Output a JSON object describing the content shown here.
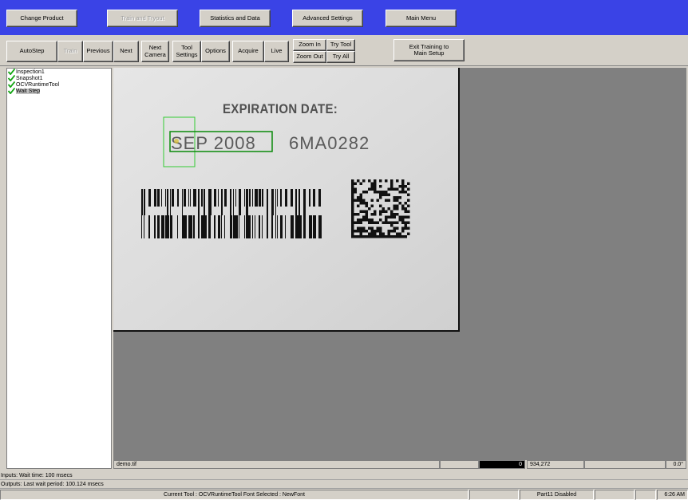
{
  "top_nav": {
    "change_product": "Change Product",
    "train_and_tryout": "Train and Tryout",
    "statistics_and_data": "Statistics and Data",
    "advanced_settings": "Advanced Settings",
    "main_menu": "Main Menu"
  },
  "toolbar": {
    "autostep": "AutoStep",
    "train": "Train",
    "previous": "Previous",
    "next": "Next",
    "next_camera": "Next Camera",
    "tool_settings": "Tool Settings",
    "options": "Options",
    "acquire": "Acquire",
    "live": "Live",
    "zoom_in": "Zoom In",
    "zoom_out": "Zoom Out",
    "try_tool": "Try Tool",
    "try_all": "Try All",
    "exit_training": "Exit Training to Main Setup"
  },
  "tree": {
    "items": [
      {
        "label": "Inspection1",
        "icon": "check-icon"
      },
      {
        "label": "Snapshot1",
        "icon": "check-icon"
      },
      {
        "label": "OCVRuntimeTool",
        "icon": "check-icon"
      },
      {
        "label": "Wait Step",
        "icon": "check-icon",
        "selected": true
      }
    ]
  },
  "image": {
    "expiration_label": "EXPIRATION DATE:",
    "date_text": "SEP 2008",
    "lot_text": "6MA0282"
  },
  "viewer_status": {
    "filename": "demo.tif",
    "pixel_value": "0",
    "coords": "934,272",
    "angle": "0.0°"
  },
  "messages": {
    "inputs": "Inputs: Wait time: 100 msecs",
    "outputs": "Outputs: Last wait period: 100.124 msecs"
  },
  "status": {
    "current_tool": "Current Tool :  OCVRuntimeTool     Font Selected : NewFont",
    "part11": "Part11 Disabled",
    "time": "6:26 AM"
  },
  "colors": {
    "title_bar": "#3a43e6",
    "check": "#13a513",
    "roi_box": "#33cc33",
    "roi_box_dark": "#0a8a0a"
  }
}
